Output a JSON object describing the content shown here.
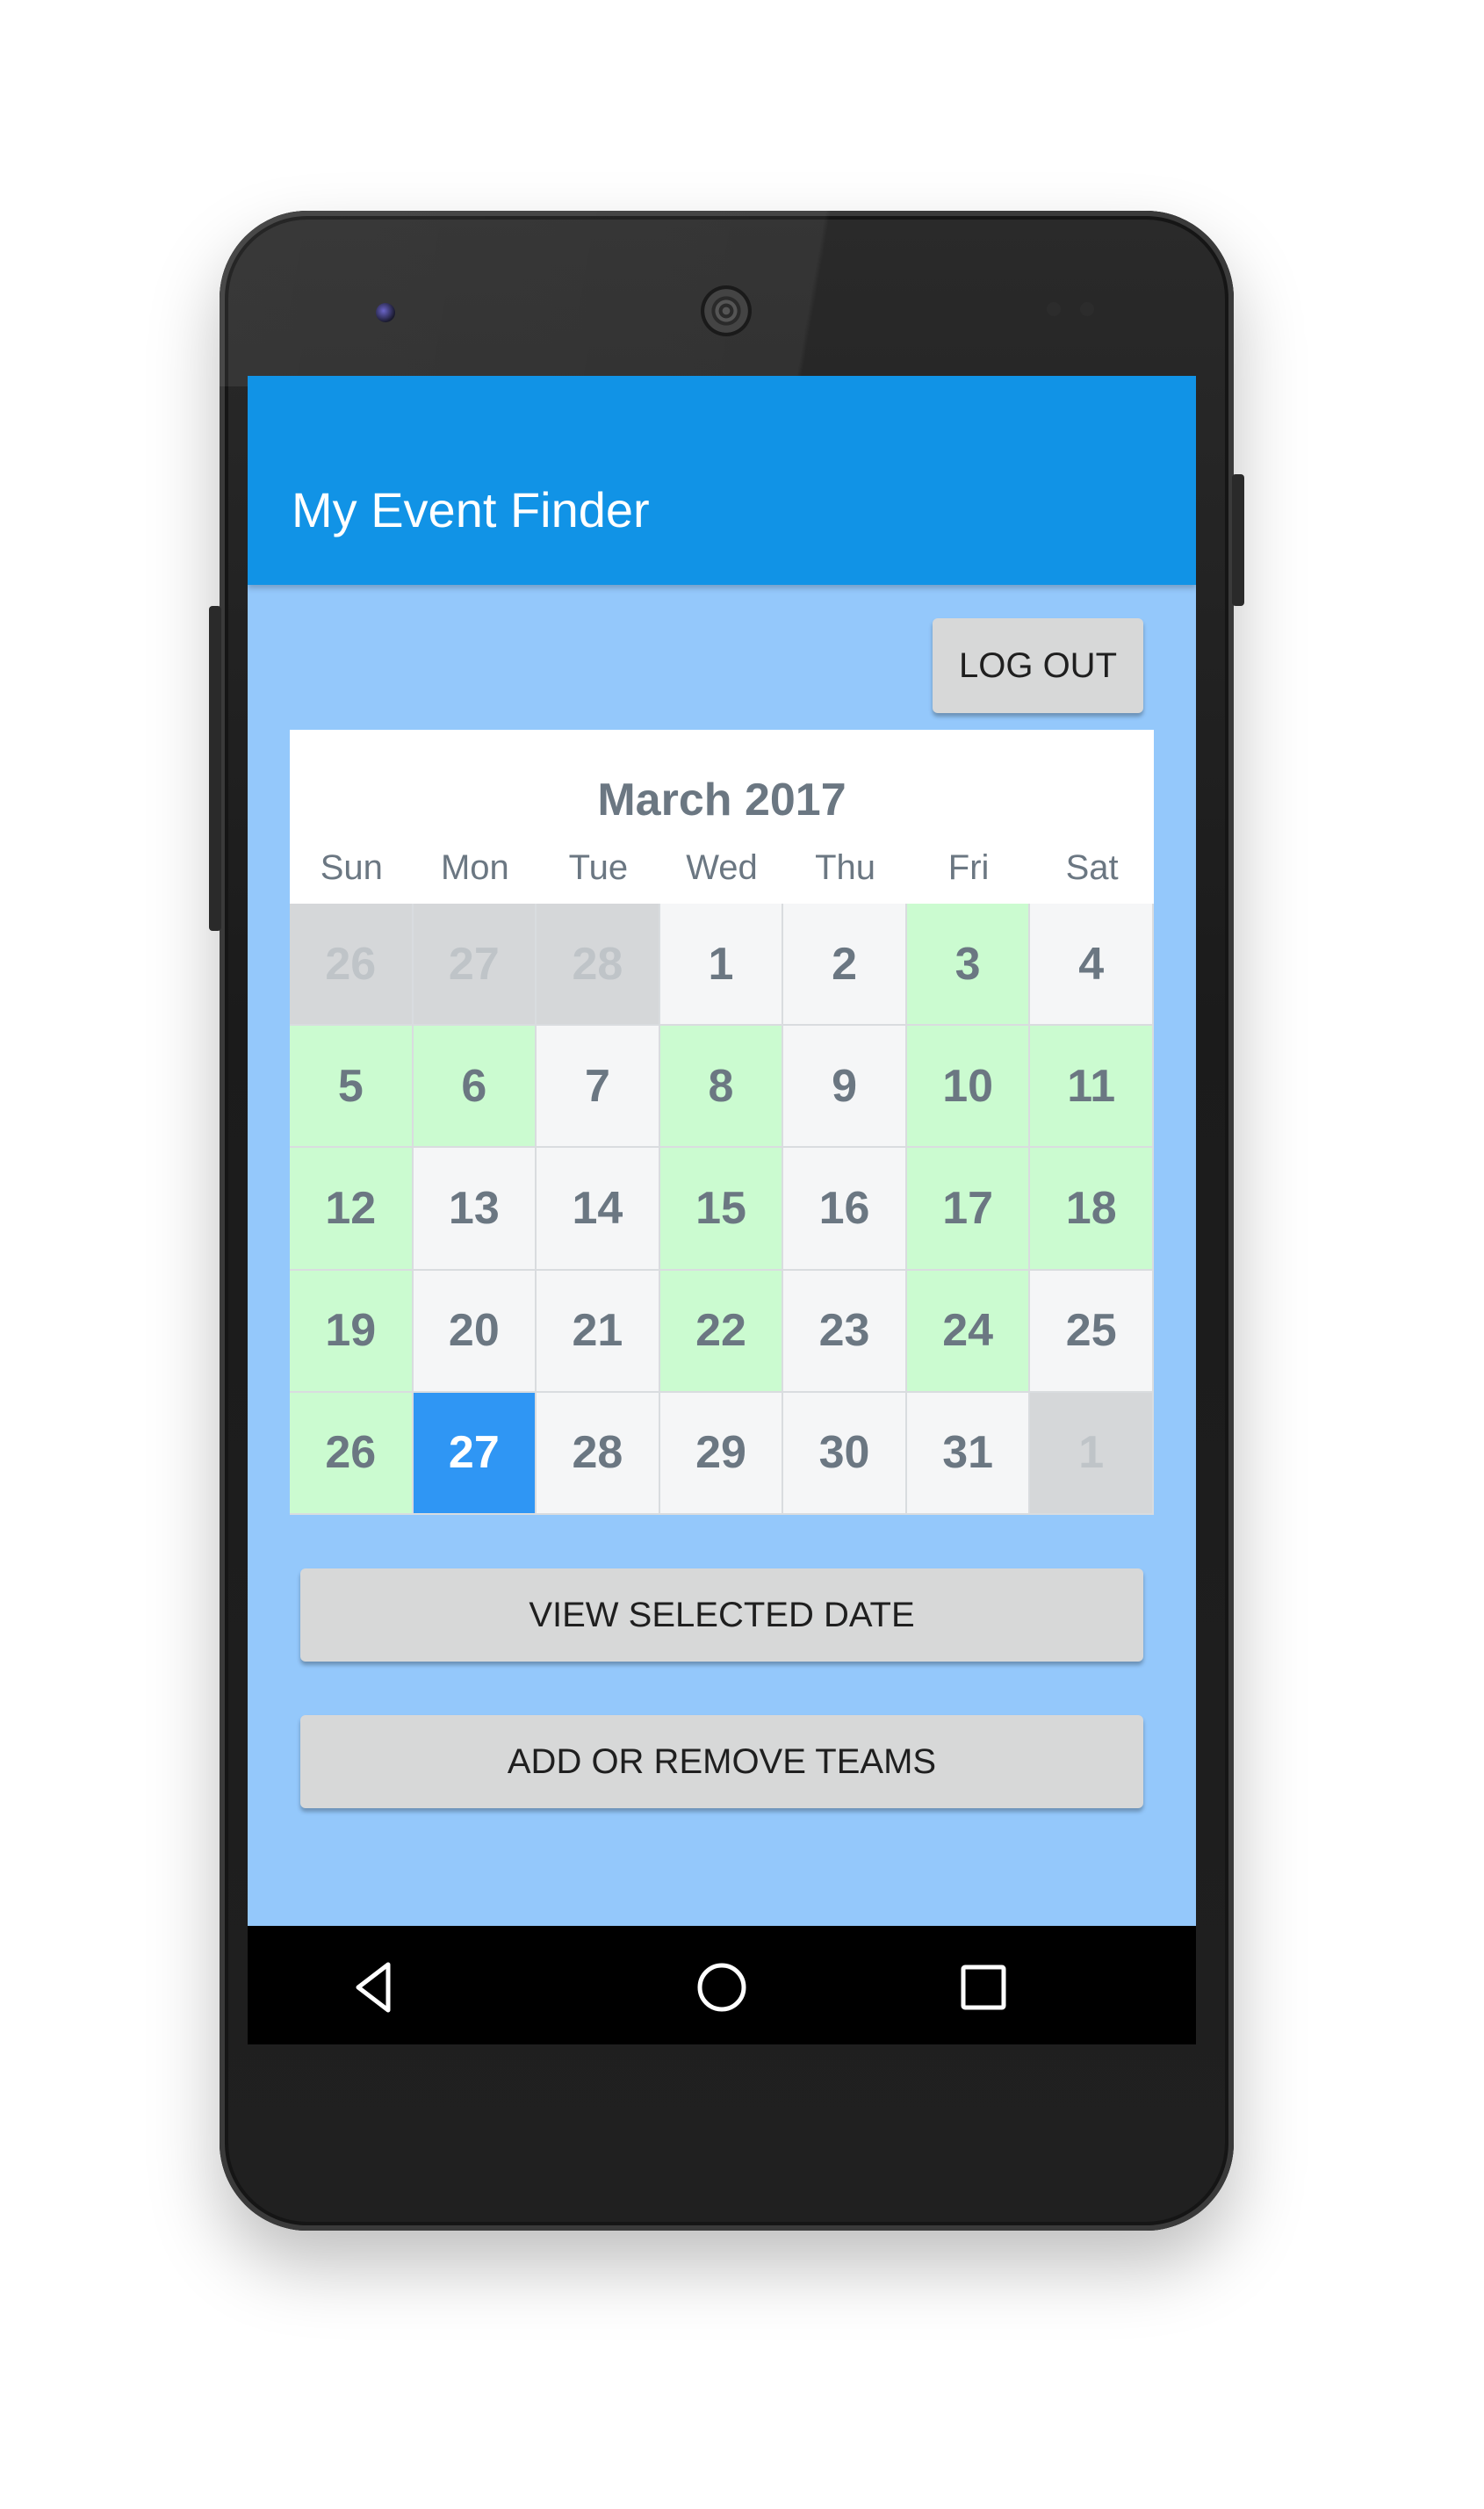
{
  "app": {
    "title": "My Event Finder"
  },
  "actions": {
    "logout_label": "LOG OUT",
    "view_selected_label": "VIEW SELECTED DATE",
    "teams_label": "ADD OR REMOVE TEAMS"
  },
  "calendar": {
    "month_label": "March 2017",
    "weekdays": [
      "Sun",
      "Mon",
      "Tue",
      "Wed",
      "Thu",
      "Fri",
      "Sat"
    ],
    "days": [
      {
        "label": "26",
        "state": "other"
      },
      {
        "label": "27",
        "state": "other"
      },
      {
        "label": "28",
        "state": "other"
      },
      {
        "label": "1",
        "state": "normal"
      },
      {
        "label": "2",
        "state": "normal"
      },
      {
        "label": "3",
        "state": "event"
      },
      {
        "label": "4",
        "state": "normal"
      },
      {
        "label": "5",
        "state": "event"
      },
      {
        "label": "6",
        "state": "event"
      },
      {
        "label": "7",
        "state": "normal"
      },
      {
        "label": "8",
        "state": "event"
      },
      {
        "label": "9",
        "state": "normal"
      },
      {
        "label": "10",
        "state": "event"
      },
      {
        "label": "11",
        "state": "event"
      },
      {
        "label": "12",
        "state": "event"
      },
      {
        "label": "13",
        "state": "normal"
      },
      {
        "label": "14",
        "state": "normal"
      },
      {
        "label": "15",
        "state": "event"
      },
      {
        "label": "16",
        "state": "normal"
      },
      {
        "label": "17",
        "state": "event"
      },
      {
        "label": "18",
        "state": "event"
      },
      {
        "label": "19",
        "state": "event"
      },
      {
        "label": "20",
        "state": "normal"
      },
      {
        "label": "21",
        "state": "normal"
      },
      {
        "label": "22",
        "state": "event"
      },
      {
        "label": "23",
        "state": "normal"
      },
      {
        "label": "24",
        "state": "event"
      },
      {
        "label": "25",
        "state": "normal"
      },
      {
        "label": "26",
        "state": "event"
      },
      {
        "label": "27",
        "state": "selected"
      },
      {
        "label": "28",
        "state": "normal"
      },
      {
        "label": "29",
        "state": "normal"
      },
      {
        "label": "30",
        "state": "normal"
      },
      {
        "label": "31",
        "state": "normal"
      },
      {
        "label": "1",
        "state": "other"
      }
    ]
  },
  "navigation": {
    "icons": [
      "back-icon",
      "home-icon",
      "recents-icon"
    ]
  },
  "colors": {
    "app_bar": "#1193e6",
    "background": "#94c8fb",
    "event_day": "#cbfbd0",
    "selected_day": "#2f96f4",
    "other_month_day": "#d5d7d9"
  }
}
